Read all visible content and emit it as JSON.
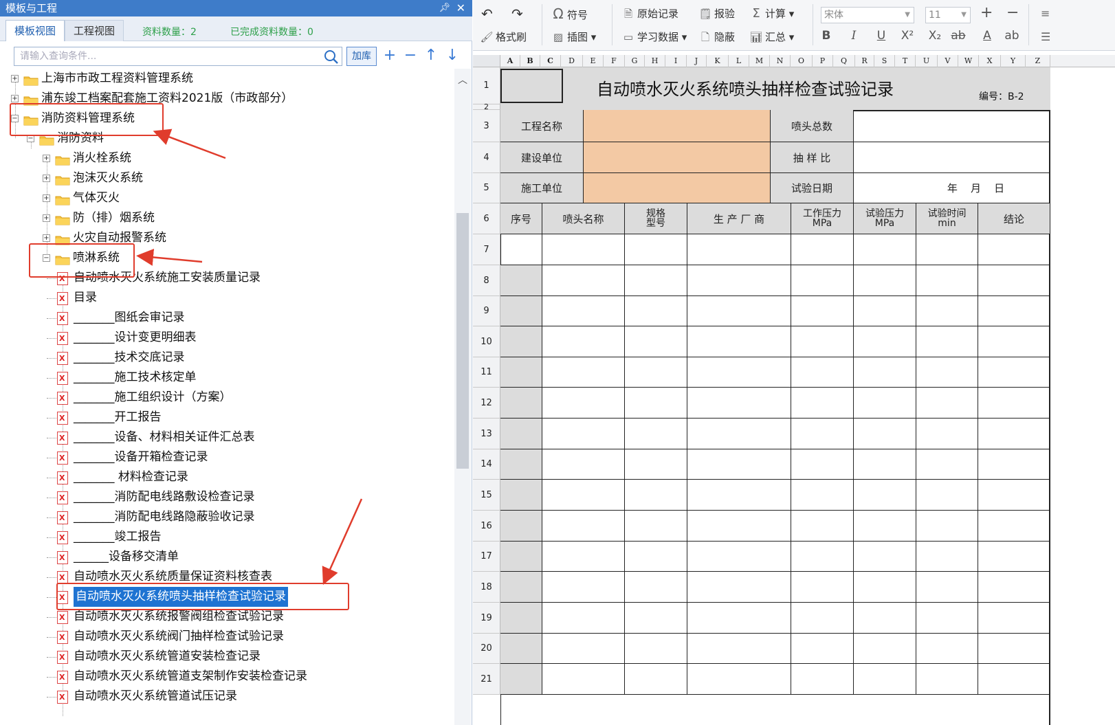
{
  "left_panel": {
    "title": "模板与工程",
    "pin_icon": "pin-icon",
    "close_icon": "close-icon",
    "tabs": [
      {
        "label": "模板视图",
        "active": true
      },
      {
        "label": "工程视图",
        "active": false
      }
    ],
    "material_count": "资料数量：2",
    "completed_count": "已完成资料数量：0",
    "search_placeholder": "请输入查询条件...",
    "add_library_button": "加库",
    "tree": [
      {
        "label": "上海市市政工程资料管理系统",
        "type": "folder",
        "expander": "+"
      },
      {
        "label": "浦东竣工档案配套施工资料2021版（市政部分）",
        "type": "folder",
        "expander": "+"
      },
      {
        "label": "消防资料管理系统",
        "type": "folder",
        "expander": "−"
      },
      {
        "label": "消防资料",
        "type": "folder",
        "expander": "−"
      },
      {
        "label": "消火栓系统",
        "type": "folder",
        "expander": "+"
      },
      {
        "label": "泡沫灭火系统",
        "type": "folder",
        "expander": "+"
      },
      {
        "label": "气体灭火",
        "type": "folder",
        "expander": "+"
      },
      {
        "label": "防（排）烟系统",
        "type": "folder",
        "expander": "+"
      },
      {
        "label": "火灾自动报警系统",
        "type": "folder",
        "expander": "+"
      },
      {
        "label": "喷淋系统",
        "type": "folder",
        "expander": "−"
      },
      {
        "label": "自动喷水灭火系统施工安装质量记录",
        "type": "file"
      },
      {
        "label": "目录",
        "type": "file"
      },
      {
        "label": "_______图纸会审记录",
        "type": "file"
      },
      {
        "label": "_______设计变更明细表",
        "type": "file"
      },
      {
        "label": "_______技术交底记录",
        "type": "file"
      },
      {
        "label": "_______施工技术核定单",
        "type": "file"
      },
      {
        "label": "_______施工组织设计（方案）",
        "type": "file"
      },
      {
        "label": "_______开工报告",
        "type": "file"
      },
      {
        "label": "_______设备、材料相关证件汇总表",
        "type": "file"
      },
      {
        "label": "_______设备开箱检查记录",
        "type": "file"
      },
      {
        "label": "_______  材料检查记录",
        "type": "file"
      },
      {
        "label": "_______消防配电线路敷设检查记录",
        "type": "file"
      },
      {
        "label": "_______消防配电线路隐蔽验收记录",
        "type": "file"
      },
      {
        "label": "_______竣工报告",
        "type": "file"
      },
      {
        "label": "______设备移交清单",
        "type": "file"
      },
      {
        "label": "自动喷水灭火系统质量保证资料核查表",
        "type": "file"
      },
      {
        "label": "自动喷水灭火系统喷头抽样检查试验记录",
        "type": "file",
        "selected": true
      },
      {
        "label": "自动喷水灭火系统报警阀组检查试验记录",
        "type": "file"
      },
      {
        "label": "自动喷水灭火系统阀门抽样检查试验记录",
        "type": "file"
      },
      {
        "label": "自动喷水灭火系统管道安装检查记录",
        "type": "file"
      },
      {
        "label": "自动喷水灭火系统管道支架制作安装检查记录",
        "type": "file"
      },
      {
        "label": "自动喷水灭火系统管道试压记录",
        "type": "file"
      }
    ]
  },
  "ribbon": {
    "symbol": "符号",
    "original_record": "原始记录",
    "report_check": "报验",
    "calculate": "计算",
    "format_painter": "格式刷",
    "insert_image": "插图",
    "learn_data": "学习数据",
    "hide": "隐蔽",
    "summary": "汇总",
    "font_name": "宋体",
    "font_size": "11"
  },
  "sheet": {
    "columns": [
      "A",
      "B",
      "C",
      "D",
      "E",
      "F",
      "G",
      "H",
      "I",
      "J",
      "K",
      "L",
      "M",
      "N",
      "O",
      "P",
      "Q",
      "R",
      "S",
      "T",
      "U",
      "V",
      "W",
      "X",
      "Y",
      "Z"
    ],
    "rows": [
      "1",
      "2",
      "3",
      "4",
      "5",
      "6",
      "7",
      "8",
      "9",
      "10",
      "11",
      "12",
      "13",
      "14",
      "15",
      "16",
      "17",
      "18",
      "19",
      "20",
      "21"
    ],
    "title": "自动喷水灭火系统喷头抽样检查试验记录",
    "code": "编号：B-2",
    "project_name_label": "工程名称",
    "nozzle_total_label": "喷头总数",
    "builder_label": "建设单位",
    "sample_ratio_label": "抽 样 比",
    "construction_label": "施工单位",
    "test_date_label": "试验日期",
    "date_value": "年    月    日",
    "table_headers": {
      "seq": "序号",
      "nozzle_name": "喷头名称",
      "spec_1": "规格",
      "spec_2": "型号",
      "manufacturer": "生 产 厂 商",
      "work_pressure_1": "工作压力",
      "work_pressure_2": "MPa",
      "test_pressure_1": "试验压力",
      "test_pressure_2": "MPa",
      "test_time_1": "试验时间",
      "test_time_2": "min",
      "conclusion": "结论"
    }
  }
}
